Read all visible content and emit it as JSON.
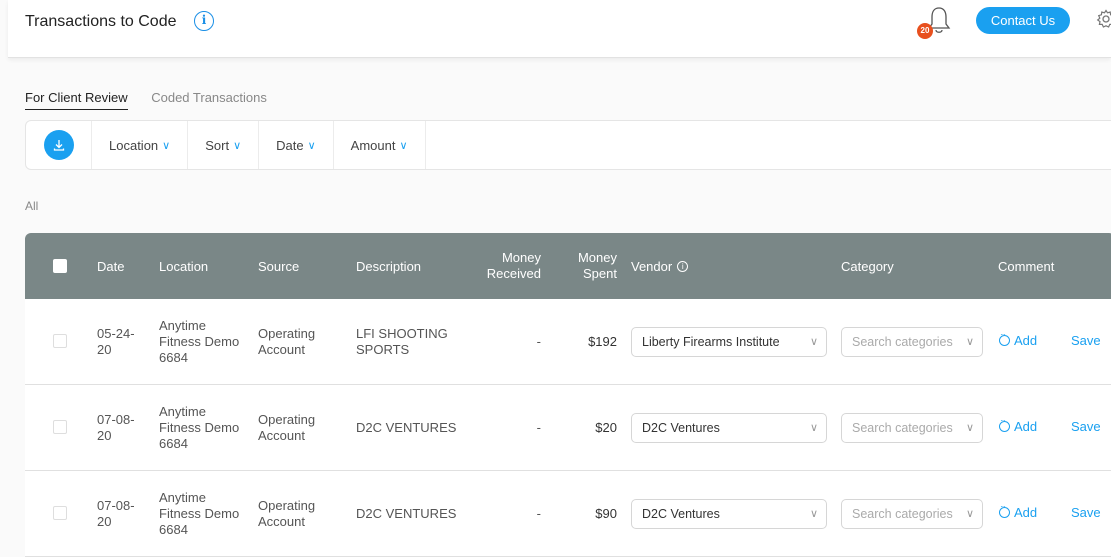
{
  "header": {
    "title": "Transactions to Code",
    "notification_count": "20",
    "contact_label": "Contact Us"
  },
  "tabs": [
    {
      "label": "For Client Review",
      "active": true
    },
    {
      "label": "Coded Transactions",
      "active": false
    }
  ],
  "filters": [
    "Location",
    "Sort",
    "Date",
    "Amount"
  ],
  "all_label": "All",
  "table": {
    "columns": {
      "date": "Date",
      "location": "Location",
      "source": "Source",
      "description": "Description",
      "money_received": "Money Received",
      "money_spent": "Money Spent",
      "vendor": "Vendor",
      "category": "Category",
      "comment": "Comment"
    },
    "rows": [
      {
        "date": "05-24-20",
        "location": "Anytime Fitness Demo 6684",
        "source": "Operating Account",
        "description": "LFI SHOOTING SPORTS",
        "received": "-",
        "spent": "$192",
        "vendor": "Liberty Firearms Institute",
        "category_placeholder": "Search categories",
        "add": "Add",
        "save": "Save"
      },
      {
        "date": "07-08-20",
        "location": "Anytime Fitness Demo 6684",
        "source": "Operating Account",
        "description": "D2C VENTURES",
        "received": "-",
        "spent": "$20",
        "vendor": "D2C Ventures",
        "category_placeholder": "Search categories",
        "add": "Add",
        "save": "Save"
      },
      {
        "date": "07-08-20",
        "location": "Anytime Fitness Demo 6684",
        "source": "Operating Account",
        "description": "D2C VENTURES",
        "received": "-",
        "spent": "$90",
        "vendor": "D2C Ventures",
        "category_placeholder": "Search categories",
        "add": "Add",
        "save": "Save"
      }
    ]
  },
  "colors": {
    "accent": "#1aa0f0",
    "table_header": "#7a8787",
    "badge": "#e8501e"
  }
}
